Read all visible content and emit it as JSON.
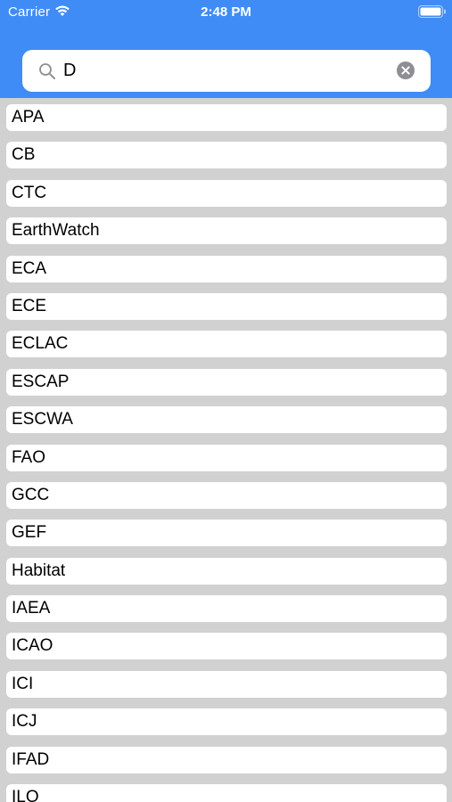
{
  "status_bar": {
    "carrier": "Carrier",
    "time": "2:48 PM"
  },
  "search": {
    "value": "D",
    "search_icon": "magnifier-icon",
    "clear_icon": "clear-circle-x-icon"
  },
  "colors": {
    "header_blue": "#3f8cf7",
    "list_background": "#d1d1d1",
    "row_background": "#ffffff"
  },
  "list": {
    "items": [
      {
        "label": "APA"
      },
      {
        "label": "CB"
      },
      {
        "label": "CTC"
      },
      {
        "label": "EarthWatch"
      },
      {
        "label": "ECA"
      },
      {
        "label": "ECE"
      },
      {
        "label": "ECLAC"
      },
      {
        "label": "ESCAP"
      },
      {
        "label": "ESCWA"
      },
      {
        "label": "FAO"
      },
      {
        "label": "GCC"
      },
      {
        "label": "GEF"
      },
      {
        "label": "Habitat"
      },
      {
        "label": "IAEA"
      },
      {
        "label": "ICAO"
      },
      {
        "label": "ICI"
      },
      {
        "label": "ICJ"
      },
      {
        "label": "IFAD"
      },
      {
        "label": "ILO"
      }
    ]
  }
}
